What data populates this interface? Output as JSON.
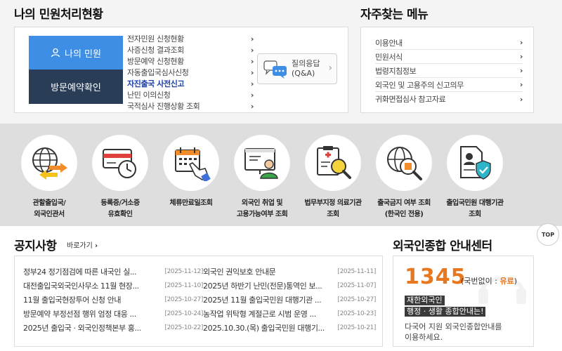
{
  "my_complaints": {
    "title": "나의 민원처리현황",
    "my_button": "나의 민원",
    "visit_button": "방문예약확인",
    "links": [
      {
        "label": "전자민원 신청현황"
      },
      {
        "label": "사증신청 결과조회"
      },
      {
        "label": "방문예약 신청현황"
      },
      {
        "label": "자동출입국심사신청"
      },
      {
        "label": "자진출국 사전신고",
        "active": true
      },
      {
        "label": "난민 이의신청"
      },
      {
        "label": "국적심사 진행상황 조회"
      }
    ],
    "qa_line1": "질의응답",
    "qa_line2": "(Q&A)"
  },
  "faq_menu": {
    "title": "자주찾는 메뉴",
    "links": [
      {
        "label": "이용안내"
      },
      {
        "label": "민원서식"
      },
      {
        "label": "법령지침정보"
      },
      {
        "label": "외국인 및 고용주의 신고의무"
      },
      {
        "label": "귀화면접심사 참고자료"
      }
    ]
  },
  "services": [
    {
      "line1": "관할출입국/",
      "line2": "외국인관서",
      "icon": "globe-office-icon"
    },
    {
      "line1": "등록증/거소증",
      "line2": "유효확인",
      "icon": "card-clock-icon"
    },
    {
      "line1": "체류만료일조회",
      "line2": "",
      "icon": "calendar-hand-icon"
    },
    {
      "line1": "외국인 취업 및",
      "line2": "고용가능여부 조회",
      "icon": "monitor-worker-icon"
    },
    {
      "line1": "법무부지정 의료기관",
      "line2": "조회",
      "icon": "clipboard-search-icon"
    },
    {
      "line1": "출국금지 여부 조회",
      "line2": "(한국인 전용)",
      "icon": "globe-search-icon"
    },
    {
      "line1": "출입국민원 대행기관",
      "line2": "조회",
      "icon": "document-shield-icon"
    }
  ],
  "notices": {
    "title": "공지사항",
    "more": "바로가기",
    "left": [
      {
        "title": "정부24 정기점검에 따른 내국인 실...",
        "date": "[2025-11-12]"
      },
      {
        "title": "대전출입국외국인사무소 11월 현장...",
        "date": "[2025-11-10]"
      },
      {
        "title": "11월 출입국현장투어 신청 안내",
        "date": "[2025-10-27]"
      },
      {
        "title": "방문예약 부정선점 행위 엄정 대응 ...",
        "date": "[2025-10-24]"
      },
      {
        "title": "2025년 출입국 · 외국인정책본부 홍...",
        "date": "[2025-10-22]"
      }
    ],
    "right": [
      {
        "title": "외국인 권익보호 안내문",
        "date": "[2025-11-11]"
      },
      {
        "title": "2025년 하반기 난민(전문)통역인 보...",
        "date": "[2025-11-07]"
      },
      {
        "title": "2025년 11월 출입국민원 대행기관 ...",
        "date": "[2025-10-27]"
      },
      {
        "title": "농작업 위탁형 계절근로 시범 운영 ...",
        "date": "[2025-10-23]"
      },
      {
        "title": "2025.10.30.(목) 출입국민원 대행기...",
        "date": "[2025-10-21]"
      }
    ]
  },
  "center": {
    "title": "외국인종합 안내센터",
    "number": "1345",
    "sub_prefix": "(국번없이 : ",
    "sub_paid": "유료",
    "sub_suffix": ")",
    "highlight1": "재한외국인",
    "highlight2": "행정 · 생활 종합안내는!",
    "desc1": "다국어 지원 외국인종합안내를",
    "desc2": "이용하세요."
  },
  "top_button": "TOP",
  "colors": {
    "blue_button": "#3f8ee5",
    "navy_button": "#2a3d57",
    "orange": "#e8781f",
    "active_link": "#1a3fa6"
  }
}
